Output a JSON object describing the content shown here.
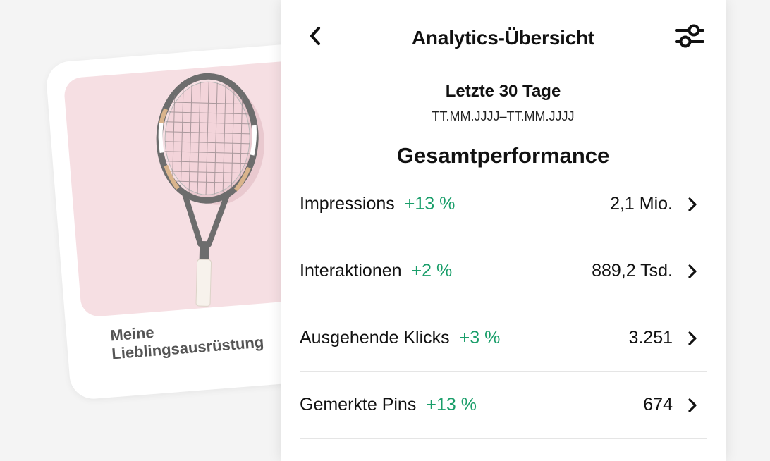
{
  "pin": {
    "title": "Meine\nLieblingsausrüstung"
  },
  "header": {
    "title": "Analytics-Übersicht",
    "back_icon": "chevron-left-icon",
    "filter_icon": "sliders-icon"
  },
  "range": {
    "label": "Letzte 30 Tage",
    "dates": "TT.MM.JJJJ–TT.MM.JJJJ"
  },
  "section": {
    "title": "Gesamtperformance"
  },
  "metrics": [
    {
      "label": "Impressions",
      "change": "+13 %",
      "value": "2,1 Mio."
    },
    {
      "label": "Interaktionen",
      "change": "+2 %",
      "value": "889,2 Tsd."
    },
    {
      "label": "Ausgehende Klicks",
      "change": "+3 %",
      "value": "3.251"
    },
    {
      "label": "Gemerkte Pins",
      "change": "+13 %",
      "value": "674"
    }
  ],
  "colors": {
    "positive": "#1a9e6a",
    "pin_background": "#f6dfe3",
    "page_background": "#f4f4f4"
  }
}
